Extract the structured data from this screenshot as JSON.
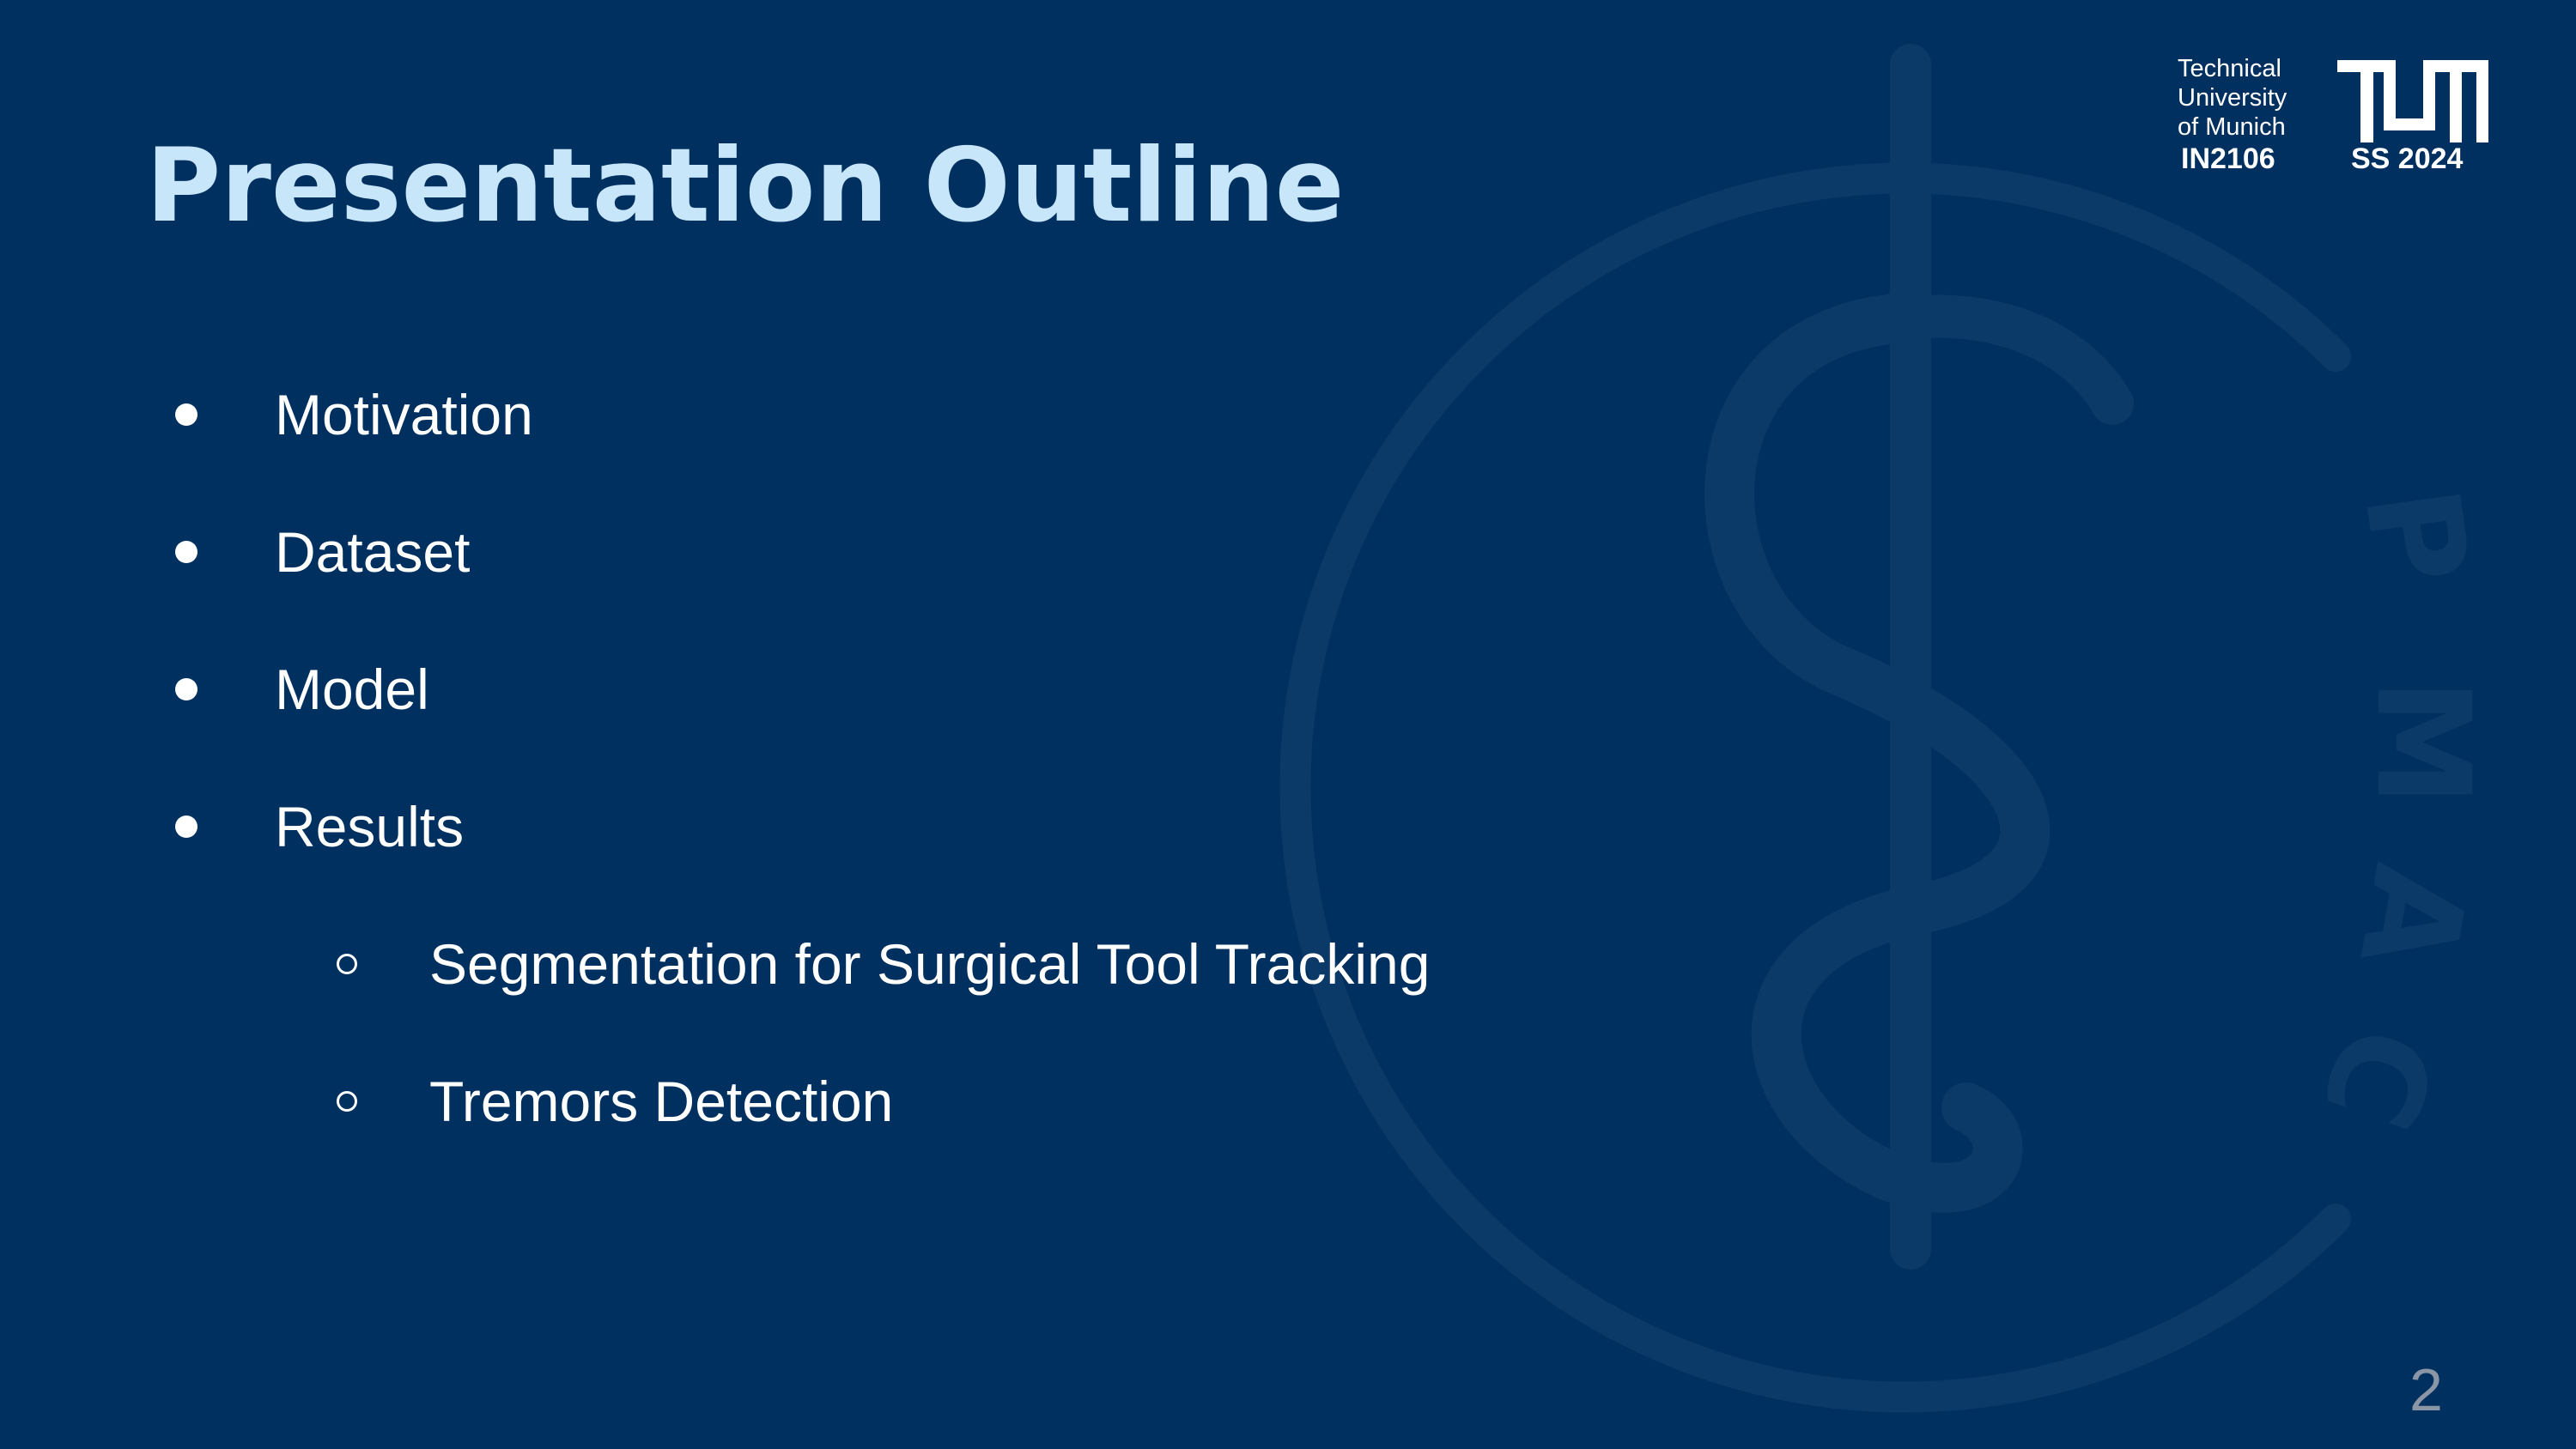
{
  "slide": {
    "title": "Presentation Outline",
    "outline": [
      {
        "text": "Motivation",
        "level": 1
      },
      {
        "text": "Dataset",
        "level": 1
      },
      {
        "text": "Model",
        "level": 1
      },
      {
        "text": "Results",
        "level": 1
      },
      {
        "text": "Segmentation for Surgical Tool Tracking",
        "level": 2
      },
      {
        "text": "Tremors Detection",
        "level": 2
      }
    ],
    "page_number": "2"
  },
  "header": {
    "university_lines": [
      "Technical",
      "University",
      "of Munich"
    ],
    "course_code": "IN2106",
    "semester": "SS 2024",
    "logo_text": "TUM",
    "watermark_text": "CAMP"
  },
  "colors": {
    "background": "#00305f",
    "title": "#c8e6fa",
    "body_text": "#ffffff",
    "page_number": "#8a95a5"
  }
}
